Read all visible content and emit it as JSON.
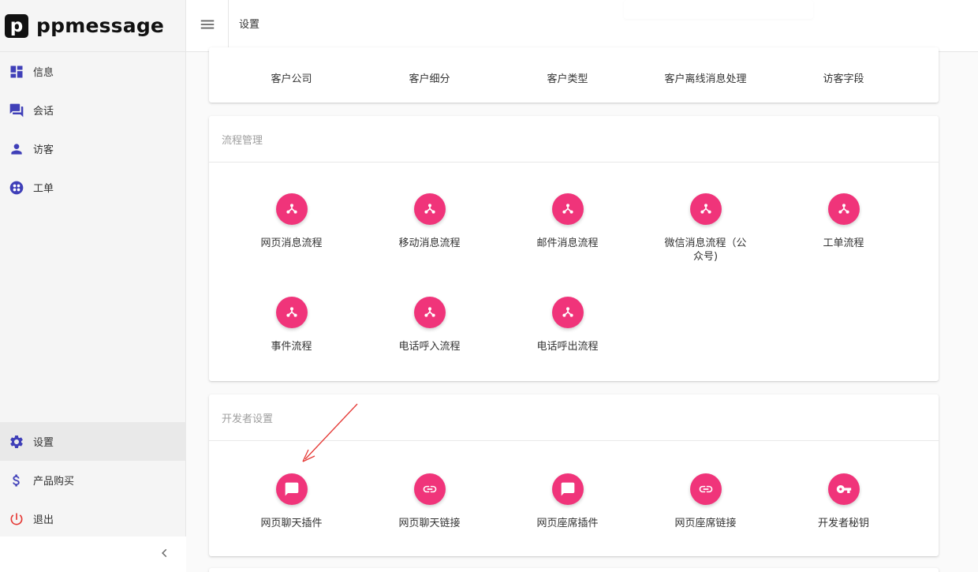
{
  "app": {
    "logo_letter": "p",
    "logo_text": "ppmessage"
  },
  "sidebar": {
    "top_items": [
      {
        "label": "信息",
        "icon": "dashboard-icon"
      },
      {
        "label": "会话",
        "icon": "forum-icon"
      },
      {
        "label": "访客",
        "icon": "person-icon"
      },
      {
        "label": "工单",
        "icon": "workorder-icon"
      }
    ],
    "bottom_items": [
      {
        "label": "设置",
        "icon": "gear-icon",
        "active": true
      },
      {
        "label": "产品购买",
        "icon": "dollar-icon"
      },
      {
        "label": "退出",
        "icon": "power-icon"
      }
    ]
  },
  "header": {
    "title": "设置"
  },
  "customer_card": {
    "items": [
      "客户公司",
      "客户细分",
      "客户类型",
      "客户离线消息处理",
      "访客字段"
    ]
  },
  "flow_card": {
    "title": "流程管理",
    "items": [
      "网页消息流程",
      "移动消息流程",
      "邮件消息流程",
      "微信消息流程（公众号)",
      "工单流程",
      "事件流程",
      "电话呼入流程",
      "电话呼出流程"
    ]
  },
  "dev_card": {
    "title": "开发者设置",
    "items": [
      {
        "label": "网页聊天插件",
        "icon": "chat-icon"
      },
      {
        "label": "网页聊天链接",
        "icon": "link-icon"
      },
      {
        "label": "网页座席插件",
        "icon": "chat-icon"
      },
      {
        "label": "网页座席链接",
        "icon": "link-icon"
      },
      {
        "label": "开发者秘钥",
        "icon": "key-icon"
      }
    ]
  },
  "colors": {
    "accent": "#f0347a",
    "nav_icon": "#3f3fb8",
    "power_icon": "#e53935",
    "annotation_arrow": "#e53935"
  }
}
